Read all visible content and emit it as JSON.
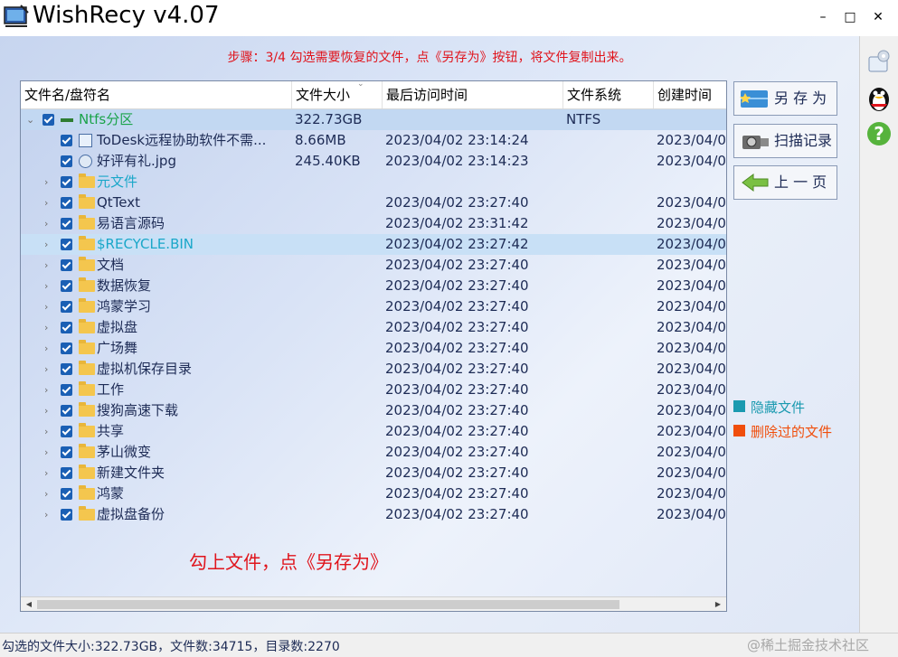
{
  "app": {
    "title": "WishRecy  v4.07",
    "minimize_glyph": "–",
    "maximize_glyph": "□",
    "close_glyph": "✕"
  },
  "step_instruction": "步骤：3/4 勾选需要恢复的文件，点《另存为》按钮，将文件复制出来。",
  "columns": [
    "文件名/盘符名",
    "文件大小",
    "最后访问时间",
    "文件系统",
    "创建时间"
  ],
  "rows": [
    {
      "expander": "⌄",
      "name": "Ntfs分区",
      "icon": "drive-icon",
      "style": "green",
      "size": "322.73GB",
      "accessed": "",
      "fs": "NTFS",
      "created": ""
    },
    {
      "expander": "",
      "name": "ToDesk远程协助软件不需...",
      "icon": "exe-file-icon",
      "style": "normal",
      "size": "8.66MB",
      "accessed": "2023/04/02 23:14:24",
      "fs": "",
      "created": "2023/04/0"
    },
    {
      "expander": "",
      "name": "好评有礼.jpg",
      "icon": "image-file-icon",
      "style": "normal",
      "size": "245.40KB",
      "accessed": "2023/04/02 23:14:23",
      "fs": "",
      "created": "2023/04/0"
    },
    {
      "expander": "›",
      "name": "元文件",
      "icon": "folder-icon",
      "style": "cyan",
      "size": "",
      "accessed": "",
      "fs": "",
      "created": ""
    },
    {
      "expander": "›",
      "name": "QtText",
      "icon": "folder-icon",
      "style": "normal",
      "size": "",
      "accessed": "2023/04/02 23:27:40",
      "fs": "",
      "created": "2023/04/0"
    },
    {
      "expander": "›",
      "name": "易语言源码",
      "icon": "folder-icon",
      "style": "normal",
      "size": "",
      "accessed": "2023/04/02 23:31:42",
      "fs": "",
      "created": "2023/04/0"
    },
    {
      "expander": "›",
      "name": "$RECYCLE.BIN",
      "icon": "folder-icon",
      "style": "cyan",
      "size": "",
      "accessed": "2023/04/02 23:27:42",
      "fs": "",
      "created": "2023/04/0"
    },
    {
      "expander": "›",
      "name": "文档",
      "icon": "folder-icon",
      "style": "normal",
      "size": "",
      "accessed": "2023/04/02 23:27:40",
      "fs": "",
      "created": "2023/04/0"
    },
    {
      "expander": "›",
      "name": "数据恢复",
      "icon": "folder-icon",
      "style": "normal",
      "size": "",
      "accessed": "2023/04/02 23:27:40",
      "fs": "",
      "created": "2023/04/0"
    },
    {
      "expander": "›",
      "name": "鸿蒙学习",
      "icon": "folder-icon",
      "style": "normal",
      "size": "",
      "accessed": "2023/04/02 23:27:40",
      "fs": "",
      "created": "2023/04/0"
    },
    {
      "expander": "›",
      "name": "虚拟盘",
      "icon": "folder-icon",
      "style": "normal",
      "size": "",
      "accessed": "2023/04/02 23:27:40",
      "fs": "",
      "created": "2023/04/0"
    },
    {
      "expander": "›",
      "name": "广场舞",
      "icon": "folder-icon",
      "style": "normal",
      "size": "",
      "accessed": "2023/04/02 23:27:40",
      "fs": "",
      "created": "2023/04/0"
    },
    {
      "expander": "›",
      "name": "虚拟机保存目录",
      "icon": "folder-icon",
      "style": "normal",
      "size": "",
      "accessed": "2023/04/02 23:27:40",
      "fs": "",
      "created": "2023/04/0"
    },
    {
      "expander": "›",
      "name": "工作",
      "icon": "folder-icon",
      "style": "normal",
      "size": "",
      "accessed": "2023/04/02 23:27:40",
      "fs": "",
      "created": "2023/04/0"
    },
    {
      "expander": "›",
      "name": "搜狗高速下载",
      "icon": "folder-icon",
      "style": "normal",
      "size": "",
      "accessed": "2023/04/02 23:27:40",
      "fs": "",
      "created": "2023/04/0"
    },
    {
      "expander": "›",
      "name": "共享",
      "icon": "folder-icon",
      "style": "normal",
      "size": "",
      "accessed": "2023/04/02 23:27:40",
      "fs": "",
      "created": "2023/04/0"
    },
    {
      "expander": "›",
      "name": "茅山微变",
      "icon": "folder-icon",
      "style": "normal",
      "size": "",
      "accessed": "2023/04/02 23:27:40",
      "fs": "",
      "created": "2023/04/0"
    },
    {
      "expander": "›",
      "name": "新建文件夹",
      "icon": "folder-icon",
      "style": "normal",
      "size": "",
      "accessed": "2023/04/02 23:27:40",
      "fs": "",
      "created": "2023/04/0"
    },
    {
      "expander": "›",
      "name": "鸿蒙",
      "icon": "folder-icon",
      "style": "normal",
      "size": "",
      "accessed": "2023/04/02 23:27:40",
      "fs": "",
      "created": "2023/04/0"
    },
    {
      "expander": "›",
      "name": "虚拟盘备份",
      "icon": "folder-icon",
      "style": "normal",
      "size": "",
      "accessed": "2023/04/02 23:27:40",
      "fs": "",
      "created": "2023/04/0"
    }
  ],
  "hint_text": "勾上文件，点《另存为》",
  "buttons": {
    "save_as": "另 存 为",
    "scan_records": "扫描记录",
    "previous_page": "上 一 页"
  },
  "legend": {
    "hidden_files": "隐藏文件",
    "deleted_files": "删除过的文件"
  },
  "colors": {
    "hidden_files": "#1a9ab0",
    "deleted_files": "#f04e0c",
    "instruction_red": "#e0141c",
    "partition_green": "#1aa34a"
  },
  "status_bar": {
    "text": "勾选的文件大小:322.73GB，文件数:34715，目录数:2270",
    "watermark": "@稀土掘金技术社区"
  }
}
